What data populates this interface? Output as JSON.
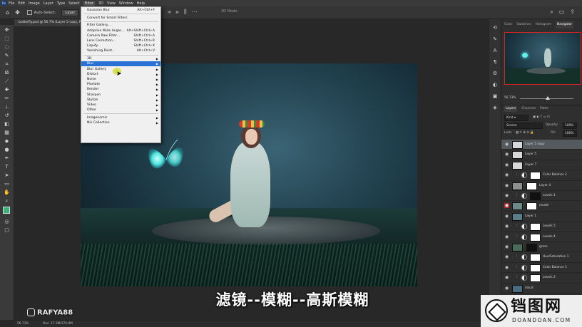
{
  "menubar": {
    "logo": "Ps",
    "items": [
      "File",
      "Edit",
      "Image",
      "Layer",
      "Type",
      "Select",
      "Filter",
      "3D",
      "View",
      "Window",
      "Help"
    ]
  },
  "optionsbar": {
    "auto_select_label": "Auto-Select:",
    "auto_select_value": "Layer",
    "mode_3d": "3D Mode:"
  },
  "document_tab": "butterfly.psd @ 56.7% (Layer 5 copy, RGB/8",
  "filter_menu": {
    "items": [
      {
        "label": "Gaussian Blur",
        "shortcut": "Alt+Ctrl+F",
        "arrow": ""
      },
      {
        "sep": true
      },
      {
        "label": "Convert for Smart Filters",
        "shortcut": "",
        "arrow": ""
      },
      {
        "sep": true
      },
      {
        "label": "Filter Gallery...",
        "shortcut": "",
        "arrow": ""
      },
      {
        "label": "Adaptive Wide Angle...",
        "shortcut": "Alt+Shift+Ctrl+A",
        "arrow": ""
      },
      {
        "label": "Camera Raw Filter...",
        "shortcut": "Shift+Ctrl+A",
        "arrow": ""
      },
      {
        "label": "Lens Correction...",
        "shortcut": "Shift+Ctrl+R",
        "arrow": ""
      },
      {
        "label": "Liquify...",
        "shortcut": "Shift+Ctrl+X",
        "arrow": ""
      },
      {
        "label": "Vanishing Point...",
        "shortcut": "Alt+Ctrl+V",
        "arrow": ""
      },
      {
        "sep": true
      },
      {
        "label": "3D",
        "shortcut": "",
        "arrow": "▶"
      },
      {
        "label": "Blur",
        "shortcut": "",
        "arrow": "▶",
        "highlight": true
      },
      {
        "label": "Blur Gallery",
        "shortcut": "",
        "arrow": "▶"
      },
      {
        "label": "Distort",
        "shortcut": "",
        "arrow": "▶"
      },
      {
        "label": "Noise",
        "shortcut": "",
        "arrow": "▶"
      },
      {
        "label": "Pixelate",
        "shortcut": "",
        "arrow": "▶"
      },
      {
        "label": "Render",
        "shortcut": "",
        "arrow": "▶"
      },
      {
        "label": "Sharpen",
        "shortcut": "",
        "arrow": "▶"
      },
      {
        "label": "Stylize",
        "shortcut": "",
        "arrow": "▶"
      },
      {
        "label": "Video",
        "shortcut": "",
        "arrow": "▶"
      },
      {
        "label": "Other",
        "shortcut": "",
        "arrow": "▶"
      },
      {
        "sep": true
      },
      {
        "label": "Imagenomic",
        "shortcut": "",
        "arrow": "▶"
      },
      {
        "label": "Nik Collection",
        "shortcut": "",
        "arrow": "▶"
      }
    ]
  },
  "panel": {
    "tabs": [
      "Color",
      "Swatches",
      "Histogram",
      "Navigator"
    ],
    "active_tab": "Navigator",
    "zoom": "56.73%",
    "layer_tabs": [
      "Layers",
      "Channels",
      "Paths"
    ],
    "active_layer_tab": "Layers",
    "kind_label": "Kind",
    "blend_mode": "Screen",
    "opacity_label": "Opacity:",
    "opacity_value": "100%",
    "lock_label": "Lock:",
    "fill_label": "Fill:",
    "fill_value": "100%"
  },
  "layers": [
    {
      "name": "Layer 5 copy",
      "type": "pixel",
      "selected": true,
      "thumb": "#d8d8d8"
    },
    {
      "name": "Layer 5",
      "type": "pixel",
      "thumb": "#d8d8d8"
    },
    {
      "name": "Layer 7",
      "type": "pixel",
      "thumb": "#d8d8d8"
    },
    {
      "name": "Color Balance 2",
      "type": "adjust"
    },
    {
      "name": "Layer 4",
      "type": "pixelmask",
      "thumb": "#8a9090"
    },
    {
      "name": "Levels 1",
      "type": "adjust",
      "mask": "#111"
    },
    {
      "name": "model",
      "type": "pixelmask",
      "thumb": "#6a8a8a",
      "red_eye": true
    },
    {
      "name": "Layer 1",
      "type": "pixel",
      "thumb": "#5a7d8a"
    },
    {
      "name": "Levels 5",
      "type": "adjust"
    },
    {
      "name": "Levels 4",
      "type": "adjust"
    },
    {
      "name": "grass",
      "type": "pixelmask",
      "thumb": "#4a6a5a",
      "mask": "#111"
    },
    {
      "name": "Hue/Saturation 1",
      "type": "adjust"
    },
    {
      "name": "Color Balance 1",
      "type": "adjust"
    },
    {
      "name": "Levels 2",
      "type": "adjust"
    },
    {
      "name": "cloud",
      "type": "pixel",
      "thumb": "#4a6a80"
    }
  ],
  "status": {
    "zoom": "56.73%",
    "doc": "Doc: 17.3M/370.8M"
  },
  "subtitle": "滤镜--模糊--高斯模糊",
  "watermark_left": "RAFYA88",
  "watermark_right": {
    "cn": "铛图网",
    "en": "DOANDOAN.COM"
  },
  "colors": {
    "foreground": "#3bb27a",
    "background": "#ffffff",
    "menu_highlight": "#2a71d6"
  }
}
